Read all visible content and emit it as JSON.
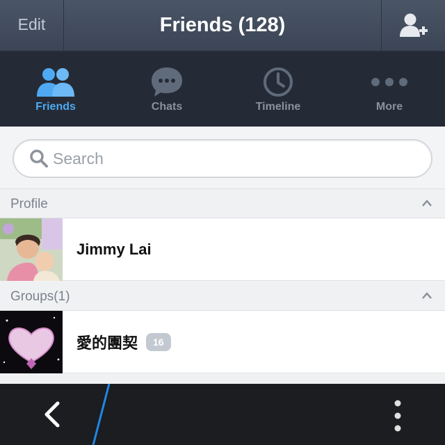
{
  "header": {
    "edit_label": "Edit",
    "title": "Friends (128)",
    "add_friend_icon": "add-friend-icon"
  },
  "tabs": [
    {
      "label": "Friends",
      "icon": "friends-icon",
      "active": true
    },
    {
      "label": "Chats",
      "icon": "chat-bubble-icon",
      "active": false
    },
    {
      "label": "Timeline",
      "icon": "clock-icon",
      "active": false
    },
    {
      "label": "More",
      "icon": "more-dots-icon",
      "active": false
    }
  ],
  "search": {
    "placeholder": "Search",
    "value": ""
  },
  "sections": {
    "profile": {
      "label": "Profile"
    },
    "groups": {
      "label": "Groups(1)"
    }
  },
  "profile": {
    "name": "Jimmy Lai"
  },
  "groups": [
    {
      "name": "愛的團契",
      "count": "16"
    }
  ],
  "colors": {
    "accent": "#4ea9f2",
    "header_bg": "#434e5f",
    "tabbar_bg": "#252b36",
    "bottom_bar": "#1b1d20",
    "bb_blue": "#1e88e5"
  },
  "bottom_bar": {
    "back_icon": "back-chevron-icon",
    "menu_icon": "overflow-menu-icon"
  }
}
